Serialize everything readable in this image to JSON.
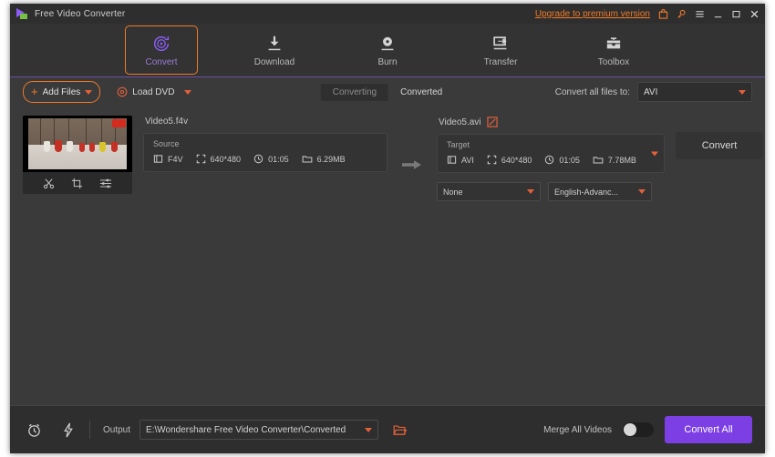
{
  "window": {
    "title": "Free Video Converter",
    "upgrade_link": "Upgrade to premium version",
    "icons": {
      "logo": "play-logo-icon",
      "cart": "cart-icon",
      "key": "key-icon",
      "menu": "hamburger-menu-icon",
      "minimize": "minimize-icon",
      "maximize": "maximize-icon",
      "close": "close-icon"
    }
  },
  "nav": {
    "active": "Convert",
    "items": [
      {
        "label": "Convert",
        "icon": "convert-circle-arrow-icon"
      },
      {
        "label": "Download",
        "icon": "download-arrow-icon"
      },
      {
        "label": "Burn",
        "icon": "burn-disc-icon"
      },
      {
        "label": "Transfer",
        "icon": "transfer-device-icon"
      },
      {
        "label": "Toolbox",
        "icon": "toolbox-icon"
      }
    ]
  },
  "toolbar": {
    "add_files": "Add Files",
    "load_dvd": "Load DVD",
    "tabs": [
      {
        "label": "Converting",
        "active": true
      },
      {
        "label": "Converted",
        "active": false
      }
    ],
    "convert_all_to_label": "Convert all files to:",
    "convert_all_to_value": "AVI"
  },
  "file": {
    "source_name": "Video5.f4v",
    "source": {
      "title": "Source",
      "format": "F4V",
      "resolution": "640*480",
      "duration": "01:05",
      "size": "6.29MB"
    },
    "target_name": "Video5.avi",
    "target": {
      "title": "Target",
      "format": "AVI",
      "resolution": "640*480",
      "duration": "01:05",
      "size": "7.78MB"
    },
    "subtitle_select": "None",
    "audio_select": "English-Advanc...",
    "convert_button": "Convert",
    "tools": [
      {
        "name": "trim-icon"
      },
      {
        "name": "crop-icon"
      },
      {
        "name": "effects-icon"
      }
    ]
  },
  "bottom": {
    "alarm_icon": "alarm-clock-icon",
    "speed_icon": "lightning-bolt-icon",
    "output_label": "Output",
    "output_path": "E:\\Wondershare Free Video Converter\\Converted",
    "folder_icon": "open-folder-icon",
    "merge_label": "Merge All Videos",
    "merge_enabled": false,
    "convert_all": "Convert All"
  },
  "colors": {
    "accent_orange": "#f07a28",
    "accent_purple": "#7b3fe4",
    "nav_active_text": "#9b7bd4",
    "window_bg": "#2b2b2b",
    "panel_bg": "#3a3a3a"
  }
}
